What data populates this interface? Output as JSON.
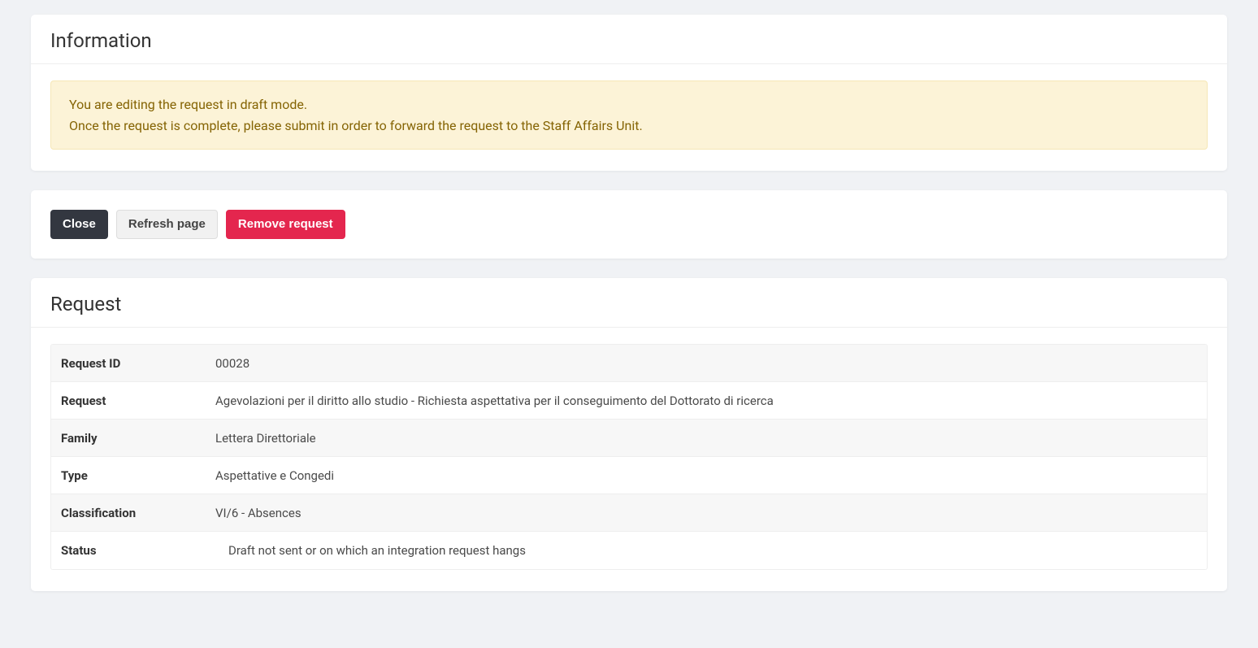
{
  "info": {
    "title": "Information",
    "alert_line1": "You are editing the request in draft mode.",
    "alert_line2": "Once the request is complete, please submit in order to forward the request to the Staff Affairs Unit."
  },
  "actions": {
    "close_label": "Close",
    "refresh_label": "Refresh page",
    "remove_label": "Remove request"
  },
  "request": {
    "title": "Request",
    "rows": [
      {
        "label": "Request ID",
        "value": "00028",
        "striped": true,
        "indent": false
      },
      {
        "label": "Request",
        "value": "Agevolazioni per il diritto allo studio - Richiesta aspettativa per il conseguimento del Dottorato di ricerca",
        "striped": false,
        "indent": false
      },
      {
        "label": "Family",
        "value": "Lettera Direttoriale",
        "striped": true,
        "indent": false
      },
      {
        "label": "Type",
        "value": "Aspettative e Congedi",
        "striped": false,
        "indent": false
      },
      {
        "label": "Classification",
        "value": "VI/6 - Absences",
        "striped": true,
        "indent": false
      },
      {
        "label": "Status",
        "value": "Draft not sent or on which an integration request hangs",
        "striped": false,
        "indent": true
      }
    ]
  }
}
